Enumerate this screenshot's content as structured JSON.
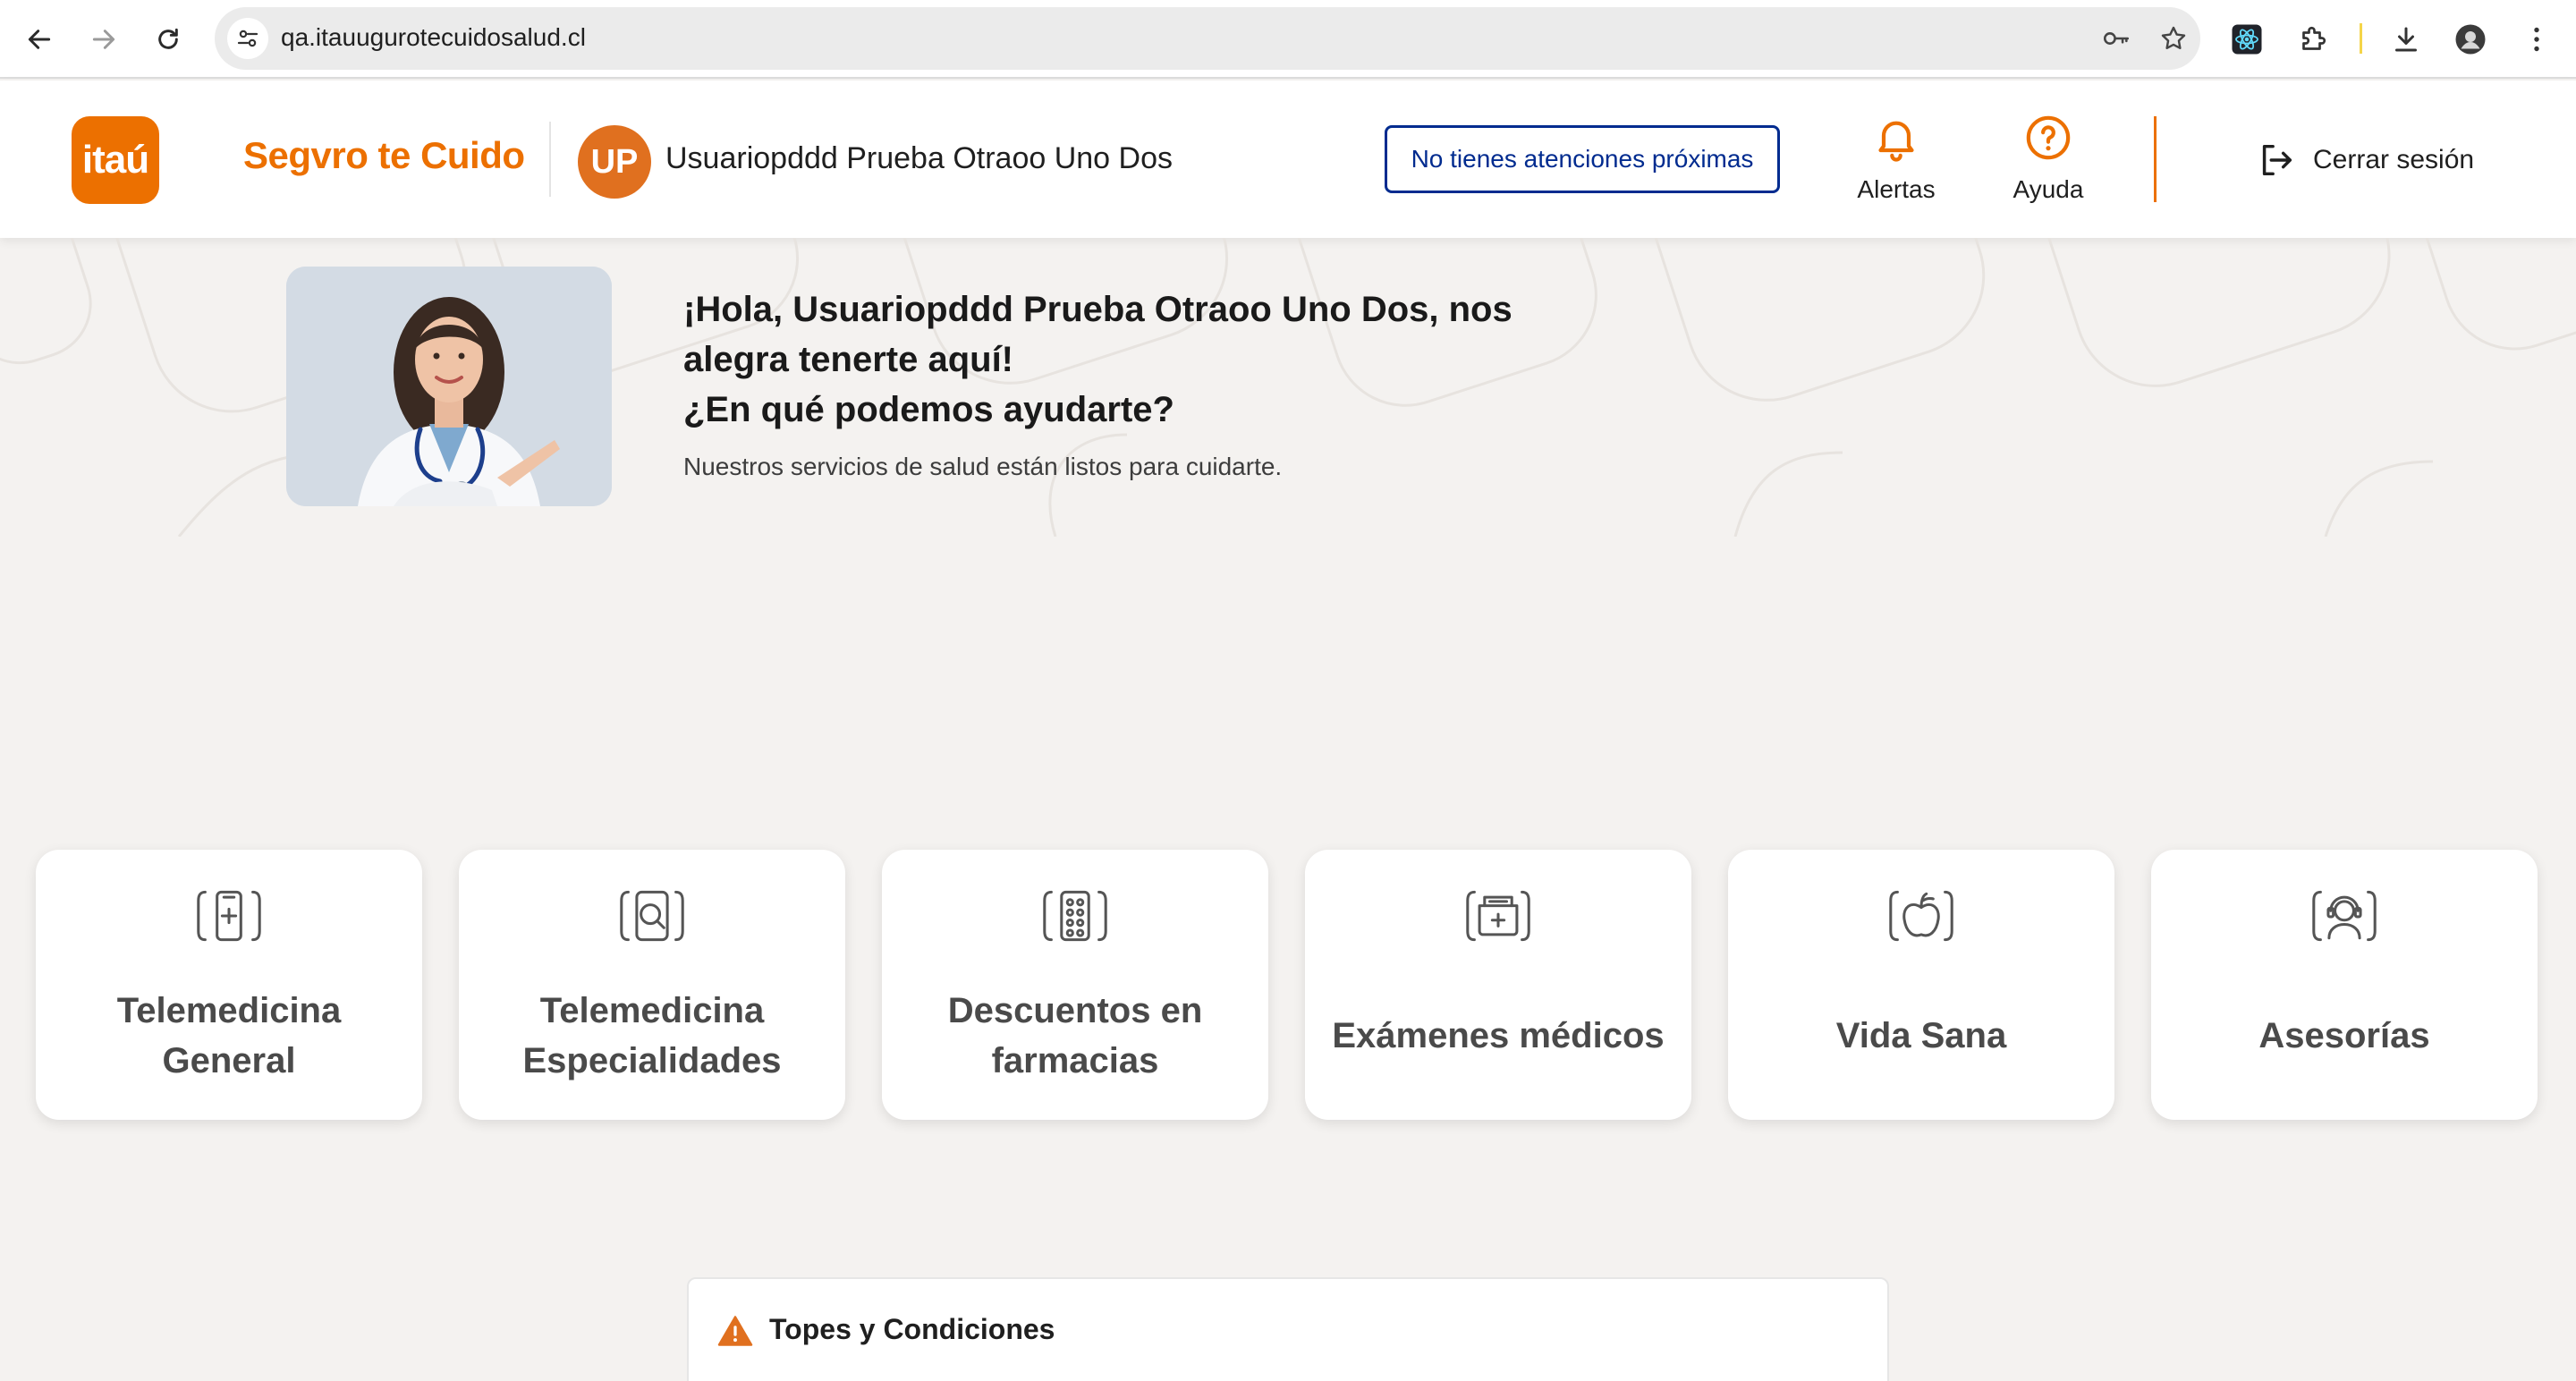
{
  "browser": {
    "url": "qa.itauugurotecuidosalud.cl",
    "buttons": {
      "back": "back-arrow-icon",
      "forward": "forward-arrow-icon",
      "reload": "reload-icon"
    },
    "toolbar_icons": [
      "key-icon",
      "star-icon",
      "react-devtools-icon",
      "extensions-puzzle-icon",
      "download-icon",
      "profile-icon",
      "more-vertical-icon"
    ]
  },
  "header": {
    "logo_text": "itaú",
    "brand_name": "Segvro te Cuido",
    "avatar_initials": "UP",
    "user_name": "Usuariopddd Prueba Otraoo Uno Dos",
    "appointments_button": "No tienes atenciones próximas",
    "alerts_label": "Alertas",
    "help_label": "Ayuda",
    "logout_label": "Cerrar sesión"
  },
  "hero": {
    "title_line1": "¡Hola, Usuariopddd Prueba Otraoo Uno Dos, nos",
    "title_line2": "alegra tenerte aquí!",
    "title_line3": "¿En qué podemos ayudarte?",
    "subtitle": "Nuestros servicios de salud están listos para cuidarte."
  },
  "services": [
    {
      "label": "Telemedicina General",
      "icon": "phone-medical-icon"
    },
    {
      "label": "Telemedicina Especialidades",
      "icon": "magnifier-medical-icon"
    },
    {
      "label": "Descuentos en farmacias",
      "icon": "pills-icon"
    },
    {
      "label": "Exámenes médicos",
      "icon": "medical-folder-icon"
    },
    {
      "label": "Vida Sana",
      "icon": "apple-icon"
    },
    {
      "label": "Asesorías",
      "icon": "headset-advisor-icon"
    }
  ],
  "topes": {
    "title": "Topes y Condiciones",
    "icon": "warning-icon"
  },
  "colors": {
    "brand_orange": "#ec7000",
    "navy": "#002b8f",
    "background": "#f4f2f0"
  }
}
